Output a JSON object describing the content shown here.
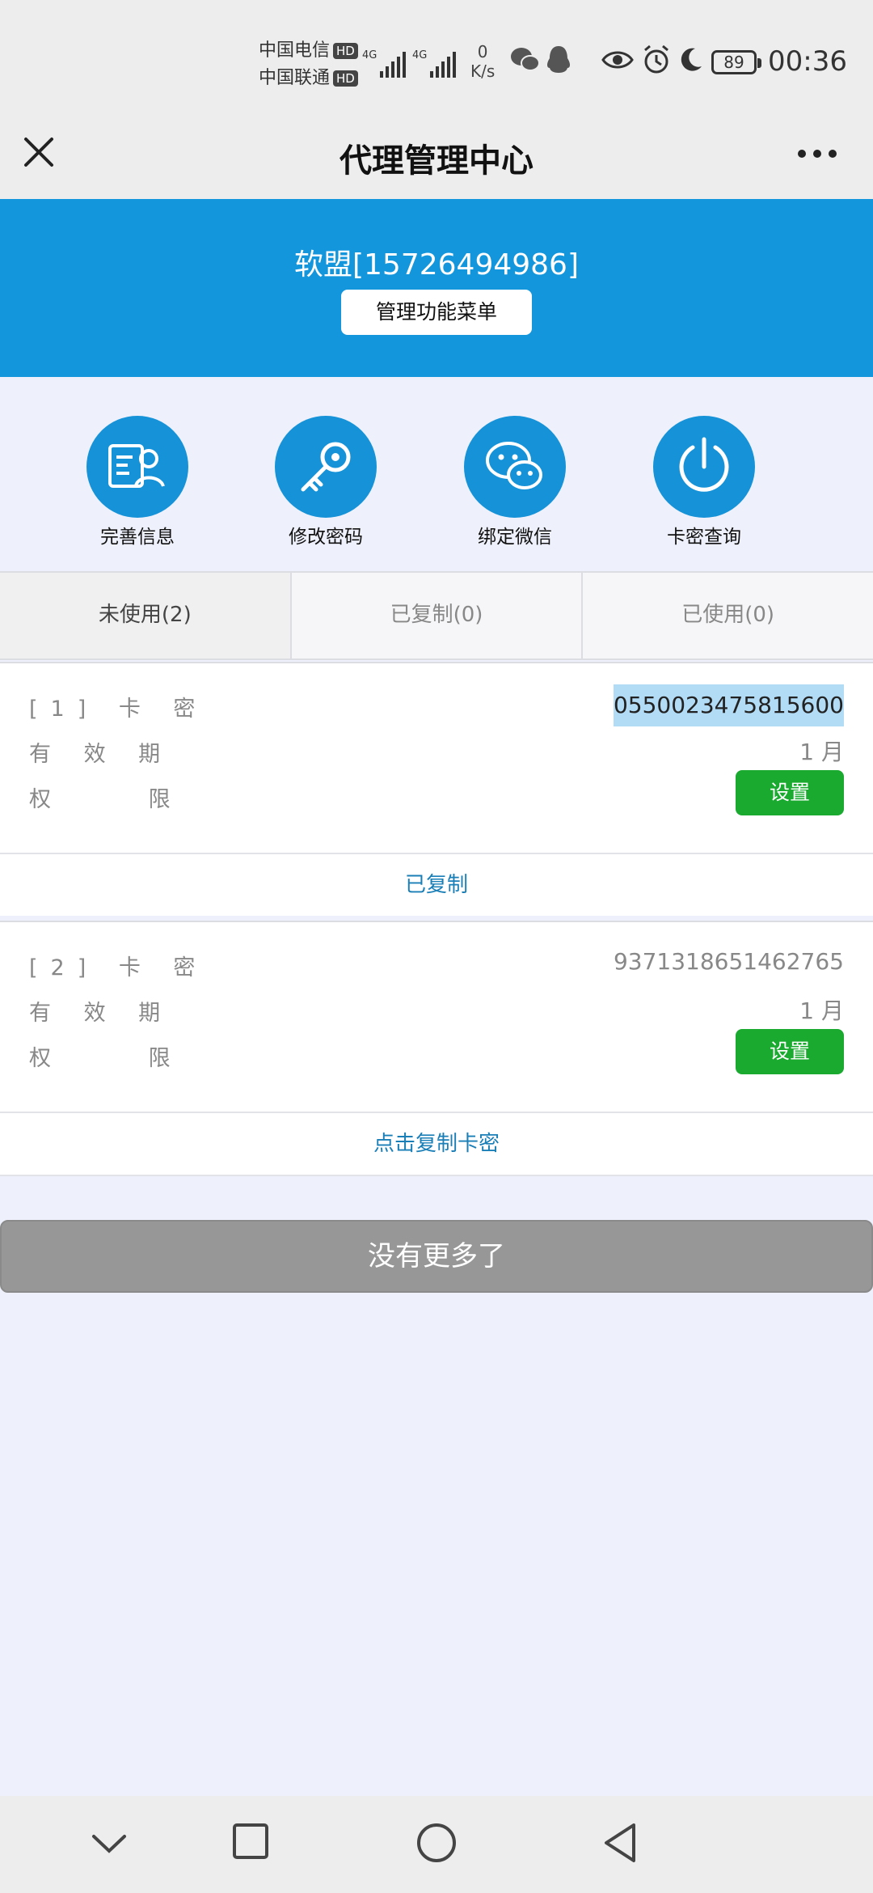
{
  "status": {
    "carrier1": "中国电信",
    "carrier2": "中国联通",
    "hd": "HD",
    "net1": "4G",
    "net2": "4G",
    "speed_value": "0",
    "speed_unit": "K/s",
    "battery": "89",
    "time": "00:36"
  },
  "header": {
    "title": "代理管理中心"
  },
  "banner": {
    "user": "软盟[15726494986]",
    "menu_button": "管理功能菜单"
  },
  "quick_actions": [
    {
      "label": "完善信息",
      "icon": "profile-card-icon"
    },
    {
      "label": "修改密码",
      "icon": "key-icon"
    },
    {
      "label": "绑定微信",
      "icon": "wechat-icon"
    },
    {
      "label": "卡密查询",
      "icon": "power-icon"
    }
  ],
  "tabs": [
    {
      "label": "未使用(2)",
      "active": true
    },
    {
      "label": "已复制(0)",
      "active": false
    },
    {
      "label": "已使用(0)",
      "active": false
    }
  ],
  "cards": [
    {
      "index_label": "[1] 卡 密",
      "code": "0550023475815600",
      "validity_label": "有 效 期",
      "validity": "1 月",
      "perm_label": "权 限",
      "perm_button": "设置",
      "action": "已复制"
    },
    {
      "index_label": "[2] 卡 密",
      "code": "9371318651462765",
      "validity_label": "有 效 期",
      "validity": "1 月",
      "perm_label": "权 限",
      "perm_button": "设置",
      "action": "点击复制卡密"
    }
  ],
  "footer": {
    "no_more": "没有更多了"
  },
  "colors": {
    "accent_blue": "#1396dc",
    "icon_blue": "#1592d8",
    "green_button": "#1aaa2f",
    "link_blue": "#1b7fb7"
  }
}
